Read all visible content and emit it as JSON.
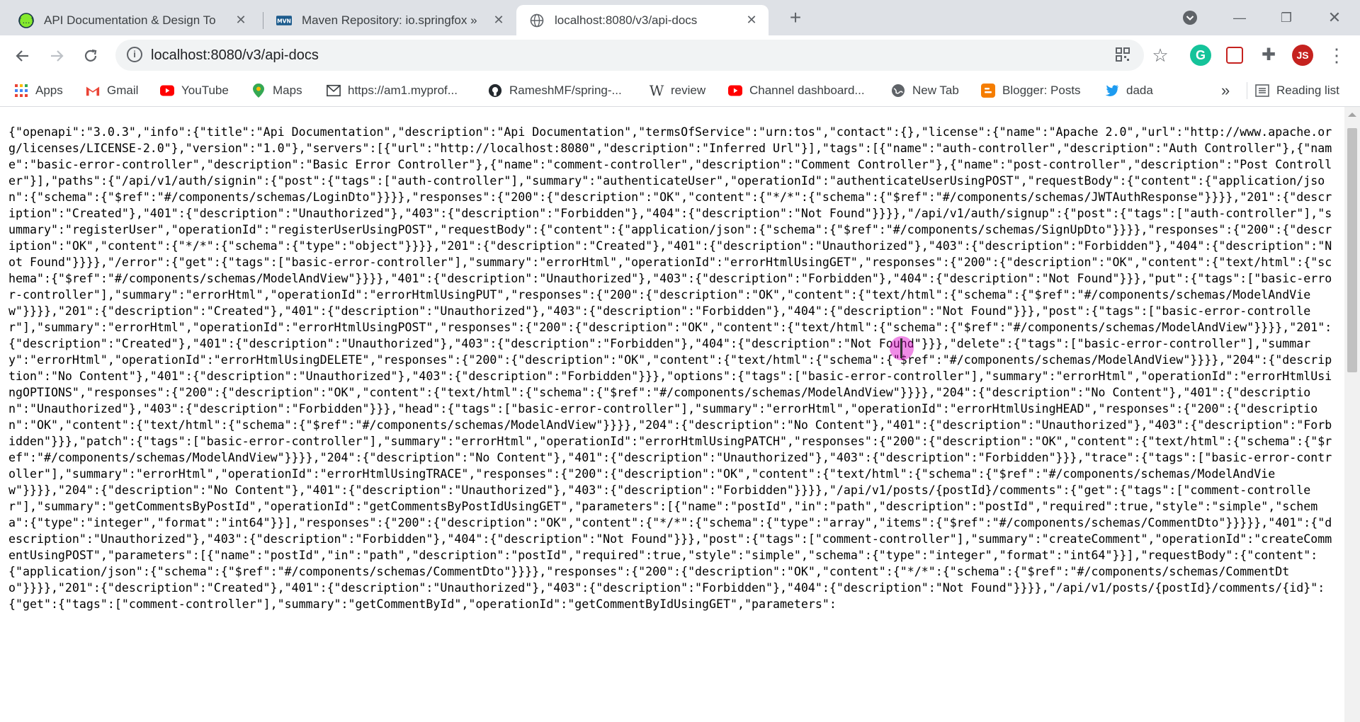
{
  "browser": {
    "tabs": [
      {
        "title": "API Documentation & Design To",
        "active": false
      },
      {
        "title": "Maven Repository: io.springfox »",
        "active": false
      },
      {
        "title": "localhost:8080/v3/api-docs",
        "active": true
      }
    ],
    "new_tab_label": "+",
    "address": "localhost:8080/v3/api-docs",
    "bookmarks": [
      {
        "label": "Apps"
      },
      {
        "label": "Gmail"
      },
      {
        "label": "YouTube"
      },
      {
        "label": "Maps"
      },
      {
        "label": "https://am1.myprof..."
      },
      {
        "label": "RameshMF/spring-..."
      },
      {
        "label": "review"
      },
      {
        "label": "Channel dashboard..."
      },
      {
        "label": "New Tab"
      },
      {
        "label": "Blogger: Posts"
      },
      {
        "label": "dada"
      }
    ],
    "more_bookmarks": "»",
    "reading_list": "Reading list",
    "profile_initials": "JS"
  },
  "page": {
    "json_text": "{\"openapi\":\"3.0.3\",\"info\":{\"title\":\"Api Documentation\",\"description\":\"Api Documentation\",\"termsOfService\":\"urn:tos\",\"contact\":{},\"license\":{\"name\":\"Apache 2.0\",\"url\":\"http://www.apache.org/licenses/LICENSE-2.0\"},\"version\":\"1.0\"},\"servers\":[{\"url\":\"http://localhost:8080\",\"description\":\"Inferred Url\"}],\"tags\":[{\"name\":\"auth-controller\",\"description\":\"Auth Controller\"},{\"name\":\"basic-error-controller\",\"description\":\"Basic Error Controller\"},{\"name\":\"comment-controller\",\"description\":\"Comment Controller\"},{\"name\":\"post-controller\",\"description\":\"Post Controller\"}],\"paths\":{\"/api/v1/auth/signin\":{\"post\":{\"tags\":[\"auth-controller\"],\"summary\":\"authenticateUser\",\"operationId\":\"authenticateUserUsingPOST\",\"requestBody\":{\"content\":{\"application/json\":{\"schema\":{\"$ref\":\"#/components/schemas/LoginDto\"}}}},\"responses\":{\"200\":{\"description\":\"OK\",\"content\":{\"*/*\":{\"schema\":{\"$ref\":\"#/components/schemas/JWTAuthResponse\"}}}},\"201\":{\"description\":\"Created\"},\"401\":{\"description\":\"Unauthorized\"},\"403\":{\"description\":\"Forbidden\"},\"404\":{\"description\":\"Not Found\"}}}},\"/api/v1/auth/signup\":{\"post\":{\"tags\":[\"auth-controller\"],\"summary\":\"registerUser\",\"operationId\":\"registerUserUsingPOST\",\"requestBody\":{\"content\":{\"application/json\":{\"schema\":{\"$ref\":\"#/components/schemas/SignUpDto\"}}}},\"responses\":{\"200\":{\"description\":\"OK\",\"content\":{\"*/*\":{\"schema\":{\"type\":\"object\"}}}},\"201\":{\"description\":\"Created\"},\"401\":{\"description\":\"Unauthorized\"},\"403\":{\"description\":\"Forbidden\"},\"404\":{\"description\":\"Not Found\"}}}},\"/error\":{\"get\":{\"tags\":[\"basic-error-controller\"],\"summary\":\"errorHtml\",\"operationId\":\"errorHtmlUsingGET\",\"responses\":{\"200\":{\"description\":\"OK\",\"content\":{\"text/html\":{\"schema\":{\"$ref\":\"#/components/schemas/ModelAndView\"}}}},\"401\":{\"description\":\"Unauthorized\"},\"403\":{\"description\":\"Forbidden\"},\"404\":{\"description\":\"Not Found\"}}},\"put\":{\"tags\":[\"basic-error-controller\"],\"summary\":\"errorHtml\",\"operationId\":\"errorHtmlUsingPUT\",\"responses\":{\"200\":{\"description\":\"OK\",\"content\":{\"text/html\":{\"schema\":{\"$ref\":\"#/components/schemas/ModelAndView\"}}}},\"201\":{\"description\":\"Created\"},\"401\":{\"description\":\"Unauthorized\"},\"403\":{\"description\":\"Forbidden\"},\"404\":{\"description\":\"Not Found\"}}},\"post\":{\"tags\":[\"basic-error-controller\"],\"summary\":\"errorHtml\",\"operationId\":\"errorHtmlUsingPOST\",\"responses\":{\"200\":{\"description\":\"OK\",\"content\":{\"text/html\":{\"schema\":{\"$ref\":\"#/components/schemas/ModelAndView\"}}}},\"201\":{\"description\":\"Created\"},\"401\":{\"description\":\"Unauthorized\"},\"403\":{\"description\":\"Forbidden\"},\"404\":{\"description\":\"Not Found\"}}},\"delete\":{\"tags\":[\"basic-error-controller\"],\"summary\":\"errorHtml\",\"operationId\":\"errorHtmlUsingDELETE\",\"responses\":{\"200\":{\"description\":\"OK\",\"content\":{\"text/html\":{\"schema\":{\"$ref\":\"#/components/schemas/ModelAndView\"}}}},\"204\":{\"description\":\"No Content\"},\"401\":{\"description\":\"Unauthorized\"},\"403\":{\"description\":\"Forbidden\"}}},\"options\":{\"tags\":[\"basic-error-controller\"],\"summary\":\"errorHtml\",\"operationId\":\"errorHtmlUsingOPTIONS\",\"responses\":{\"200\":{\"description\":\"OK\",\"content\":{\"text/html\":{\"schema\":{\"$ref\":\"#/components/schemas/ModelAndView\"}}}},\"204\":{\"description\":\"No Content\"},\"401\":{\"description\":\"Unauthorized\"},\"403\":{\"description\":\"Forbidden\"}}},\"head\":{\"tags\":[\"basic-error-controller\"],\"summary\":\"errorHtml\",\"operationId\":\"errorHtmlUsingHEAD\",\"responses\":{\"200\":{\"description\":\"OK\",\"content\":{\"text/html\":{\"schema\":{\"$ref\":\"#/components/schemas/ModelAndView\"}}}},\"204\":{\"description\":\"No Content\"},\"401\":{\"description\":\"Unauthorized\"},\"403\":{\"description\":\"Forbidden\"}}},\"patch\":{\"tags\":[\"basic-error-controller\"],\"summary\":\"errorHtml\",\"operationId\":\"errorHtmlUsingPATCH\",\"responses\":{\"200\":{\"description\":\"OK\",\"content\":{\"text/html\":{\"schema\":{\"$ref\":\"#/components/schemas/ModelAndView\"}}}},\"204\":{\"description\":\"No Content\"},\"401\":{\"description\":\"Unauthorized\"},\"403\":{\"description\":\"Forbidden\"}}},\"trace\":{\"tags\":[\"basic-error-controller\"],\"summary\":\"errorHtml\",\"operationId\":\"errorHtmlUsingTRACE\",\"responses\":{\"200\":{\"description\":\"OK\",\"content\":{\"text/html\":{\"schema\":{\"$ref\":\"#/components/schemas/ModelAndView\"}}}},\"204\":{\"description\":\"No Content\"},\"401\":{\"description\":\"Unauthorized\"},\"403\":{\"description\":\"Forbidden\"}}}},\"/api/v1/posts/{postId}/comments\":{\"get\":{\"tags\":[\"comment-controller\"],\"summary\":\"getCommentsByPostId\",\"operationId\":\"getCommentsByPostIdUsingGET\",\"parameters\":[{\"name\":\"postId\",\"in\":\"path\",\"description\":\"postId\",\"required\":true,\"style\":\"simple\",\"schema\":{\"type\":\"integer\",\"format\":\"int64\"}}],\"responses\":{\"200\":{\"description\":\"OK\",\"content\":{\"*/*\":{\"schema\":{\"type\":\"array\",\"items\":{\"$ref\":\"#/components/schemas/CommentDto\"}}}}},\"401\":{\"description\":\"Unauthorized\"},\"403\":{\"description\":\"Forbidden\"},\"404\":{\"description\":\"Not Found\"}}},\"post\":{\"tags\":[\"comment-controller\"],\"summary\":\"createComment\",\"operationId\":\"createCommentUsingPOST\",\"parameters\":[{\"name\":\"postId\",\"in\":\"path\",\"description\":\"postId\",\"required\":true,\"style\":\"simple\",\"schema\":{\"type\":\"integer\",\"format\":\"int64\"}}],\"requestBody\":{\"content\":{\"application/json\":{\"schema\":{\"$ref\":\"#/components/schemas/CommentDto\"}}}},\"responses\":{\"200\":{\"description\":\"OK\",\"content\":{\"*/*\":{\"schema\":{\"$ref\":\"#/components/schemas/CommentDto\"}}}},\"201\":{\"description\":\"Created\"},\"401\":{\"description\":\"Unauthorized\"},\"403\":{\"description\":\"Forbidden\"},\"404\":{\"description\":\"Not Found\"}}}},\"/api/v1/posts/{postId}/comments/{id}\":{\"get\":{\"tags\":[\"comment-controller\"],\"summary\":\"getCommentById\",\"operationId\":\"getCommentByIdUsingGET\",\"parameters\":"
  },
  "colors": {
    "tabstrip_bg": "#dee1e6",
    "cursor_highlight": "#dc00c8",
    "profile_avatar": "#c5221f",
    "grammarly": "#15c39a"
  }
}
